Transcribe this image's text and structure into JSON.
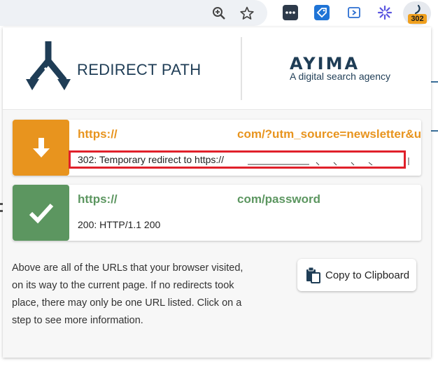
{
  "toolbar": {
    "extension_badge": "302"
  },
  "popup": {
    "logo_title": "REDIRECT PATH",
    "ayima_wordmark": "AYIMA",
    "ayima_tagline": "A digital search agency",
    "steps": [
      {
        "url_start": "https://",
        "url_end": "com/?utm_source=newsletter&u",
        "status": "302: Temporary redirect to https://",
        "kind": "redirect",
        "color": "#e8941e"
      },
      {
        "url_start": "https://",
        "url_end": "com/password",
        "status": "200: HTTP/1.1 200",
        "kind": "ok",
        "color": "#5c9660"
      }
    ],
    "info_text": "Above are all of the URLs that your browser visited, on its way to the current page. If no redirects took place, there may only be one URL listed. Click on a step to see more information.",
    "copy_button_label": "Copy to Clipboard"
  },
  "colors": {
    "redirect": "#e8941e",
    "ok": "#5c9660",
    "highlight": "#e0202a",
    "brand": "#1f3d56"
  }
}
